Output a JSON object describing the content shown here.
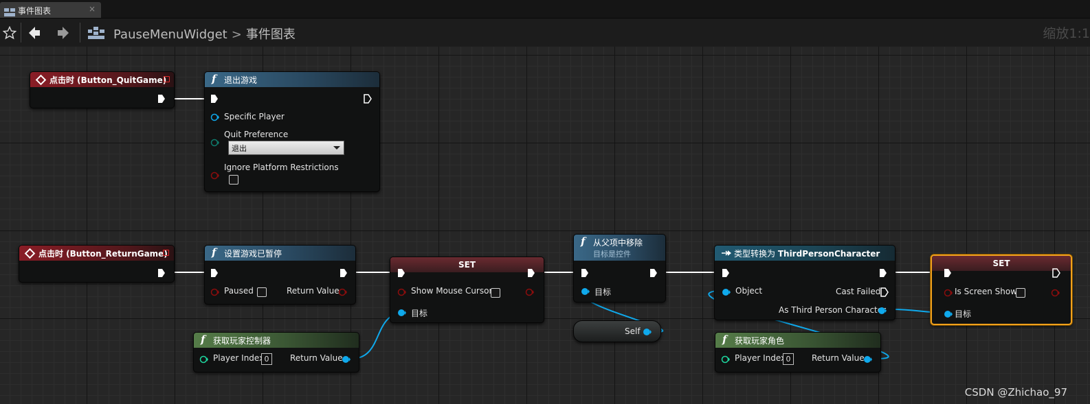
{
  "tab": {
    "title": "事件图表",
    "close": "×"
  },
  "toolbar": {
    "breadcrumb_root": "PauseMenuWidget",
    "breadcrumb_separator": ">",
    "breadcrumb_current": "事件图表",
    "zoom": "缩放1:1"
  },
  "nodes": {
    "event_quit": {
      "title": "点击时 (Button_QuitGame)"
    },
    "quit_game": {
      "title": "退出游戏",
      "specific_player": "Specific Player",
      "quit_preference": "Quit Preference",
      "quit_preference_value": "退出",
      "ignore_platform": "Ignore Platform Restrictions",
      "ignore_platform_checked": false
    },
    "event_return": {
      "title": "点击时 (Button_ReturnGame)"
    },
    "set_paused": {
      "title": "设置游戏已暂停",
      "paused": "Paused",
      "paused_checked": false,
      "return_value": "Return Value"
    },
    "set_cursor": {
      "title": "SET",
      "show_mouse_cursor": "Show Mouse Cursor",
      "show_mouse_cursor_checked": false,
      "target": "目标"
    },
    "get_pc": {
      "title": "获取玩家控制器",
      "player_index": "Player Index",
      "player_index_value": "0",
      "return_value": "Return Value"
    },
    "remove_parent": {
      "title": "从父项中移除",
      "subtitle": "目标是控件",
      "target": "目标"
    },
    "self_node": {
      "label": "Self"
    },
    "cast": {
      "title_prefix": "类型转换为",
      "title_class": "ThirdPersonCharacter",
      "object": "Object",
      "cast_failed": "Cast Failed",
      "as_tpc": "As Third Person Character"
    },
    "get_char": {
      "title": "获取玩家角色",
      "player_index": "Player Index",
      "player_index_value": "0",
      "return_value": "Return Value"
    },
    "set_screen": {
      "title": "SET",
      "is_screen_show": "Is Screen Show",
      "is_screen_show_checked": false,
      "target": "目标"
    }
  },
  "colors": {
    "exec_wire": "#ffffff",
    "object_pin": "#0fa9ec",
    "bool_pin": "#8c0d0d",
    "selection": "#f1a11c"
  },
  "watermark": "CSDN @Zhichao_97"
}
